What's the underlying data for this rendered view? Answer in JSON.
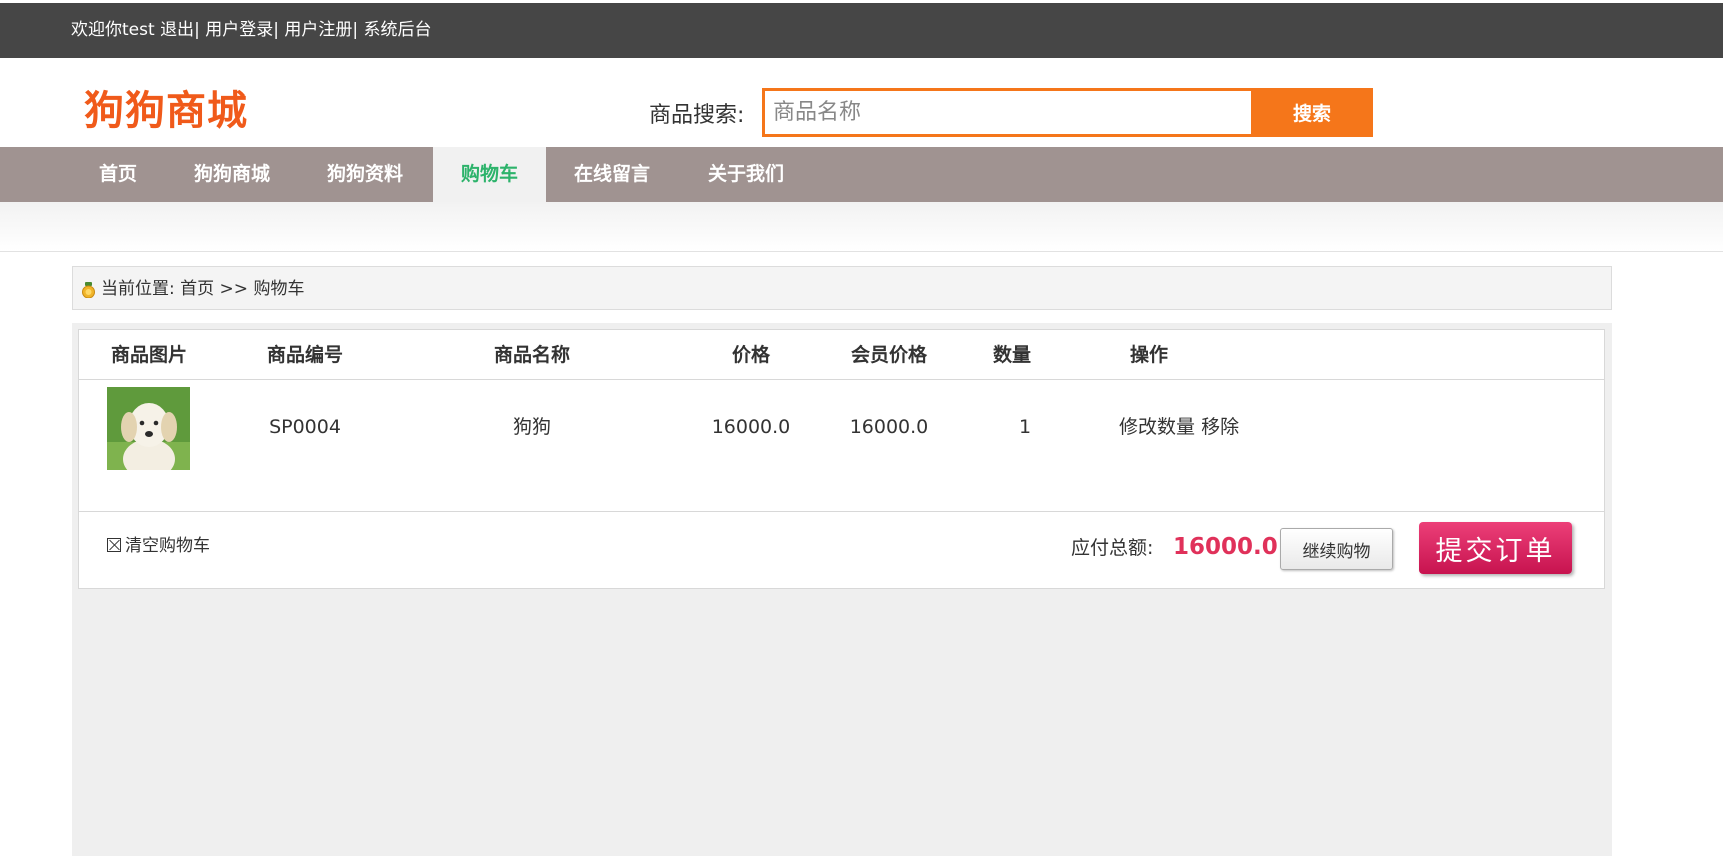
{
  "topbar": {
    "welcome": "欢迎你test",
    "logout": "退出",
    "login": "用户登录",
    "register": "用户注册",
    "admin": "系统后台"
  },
  "header": {
    "logo": "狗狗商城",
    "search_label": "商品搜索:",
    "search_placeholder": "商品名称",
    "search_button": "搜索"
  },
  "nav": {
    "items": [
      {
        "label": "首页",
        "active": false
      },
      {
        "label": "狗狗商城",
        "active": false
      },
      {
        "label": "狗狗资料",
        "active": false
      },
      {
        "label": "购物车",
        "active": true
      },
      {
        "label": "在线留言",
        "active": false
      },
      {
        "label": "关于我们",
        "active": false
      }
    ],
    "active_color": "#2db36b"
  },
  "breadcrumb": {
    "label": "当前位置:",
    "home": "首页",
    "separator": ">>",
    "current": "购物车"
  },
  "cart": {
    "columns": [
      "商品图片",
      "商品编号",
      "商品名称",
      "价格",
      "会员价格",
      "数量",
      "操作"
    ],
    "rows": [
      {
        "image": "puppy-photo",
        "code": "SP0004",
        "name": "狗狗",
        "price": "16000.0",
        "member_price": "16000.0",
        "quantity": "1",
        "action_edit": "修改数量",
        "action_remove": "移除"
      }
    ],
    "clear_label": "清空购物车",
    "total_label": "应付总额:",
    "total_value": "16000.0",
    "continue_label": "继续购物",
    "submit_label": "提交订单"
  },
  "colors": {
    "topbar": "#464646",
    "logo": "#f05a1a",
    "search_accent": "#f5761a",
    "nav_bg": "#a09391",
    "total": "#e0315a",
    "submit": "#d81e5b"
  }
}
